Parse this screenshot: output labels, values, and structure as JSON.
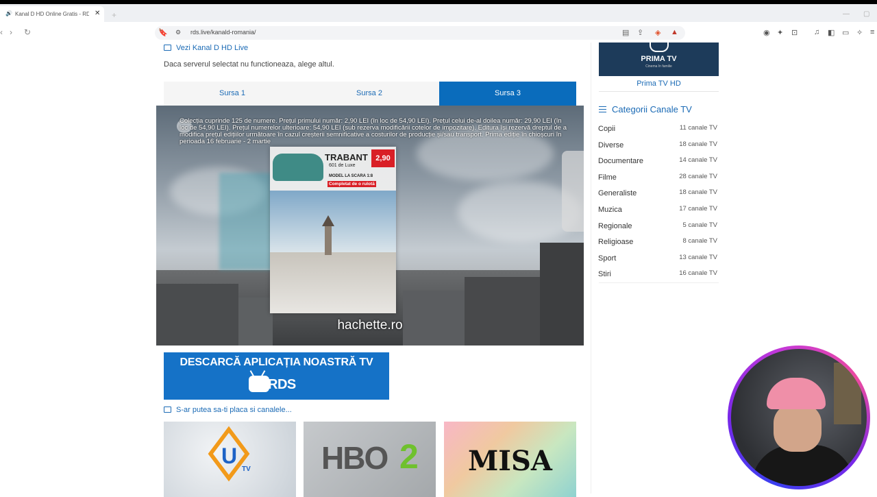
{
  "browser": {
    "tab_title": "Kanal D HD Online Gratis - RDS",
    "tab_audio_icon": "speaker-icon",
    "url": "rds.live/kanald-romania/"
  },
  "page": {
    "live_title": "Vezi Kanal D HD Live",
    "server_note": "Daca serverul selectat nu functioneaza, alege altul.",
    "sources": [
      "Sursa 1",
      "Sursa 2",
      "Sursa 3"
    ],
    "active_source": "Sursa 3",
    "player": {
      "disclaimer": "Colecția cuprinde 125 de numere. Prețul primului număr: 2,90 LEI (în loc de 54,90 LEI). Prețul celui de-al doilea număr: 29,90 LEI (în loc de 54,90 LEI). Prețul numerelor ulterioare: 54,90 LEI (sub rezerva modificării cotelor de impozitare). Editura își rezervă dreptul de a modifica prețul edițiilor următoare în cazul creșterii semnificative a costurilor de producție și/sau transport. Prima ediție în chioșcuri în perioada 16 februarie - 2 martie",
      "ad_title": "TRABANT",
      "ad_price": "2,90",
      "ad_sub1": "601 de Luxe",
      "ad_sub2": "MODEL LA SCARA 1:8",
      "ad_sub3": "Completat de o rulotă",
      "watermark": "hachette.ro"
    },
    "app_banner": {
      "text": "DESCARCĂ APLICAȚIA NOASTRĂ TV",
      "brand": "RDS"
    },
    "suggest_title": "S-ar putea sa-ti placa si canalele...",
    "thumbs": [
      {
        "name": "QU TV",
        "label": "TV"
      },
      {
        "name": "HBO2",
        "hbo": "HBO",
        "two": "2"
      },
      {
        "name": "MISA",
        "label": "MISA"
      }
    ]
  },
  "sidebar": {
    "prima": {
      "logo": "PRIMA TV",
      "tagline": "Cinema în familie",
      "label": "Prima TV HD"
    },
    "categories_title_a": "Categorii",
    "categories_title_b": "Canale TV",
    "categories": [
      {
        "name": "Copii",
        "count": "11 canale TV"
      },
      {
        "name": "Diverse",
        "count": "18 canale TV"
      },
      {
        "name": "Documentare",
        "count": "14 canale TV"
      },
      {
        "name": "Filme",
        "count": "28 canale TV"
      },
      {
        "name": "Generaliste",
        "count": "18 canale TV"
      },
      {
        "name": "Muzica",
        "count": "17 canale TV"
      },
      {
        "name": "Regionale",
        "count": "5 canale TV"
      },
      {
        "name": "Religioase",
        "count": "8 canale TV"
      },
      {
        "name": "Sport",
        "count": "13 canale TV"
      },
      {
        "name": "Stiri",
        "count": "16 canale TV"
      }
    ]
  },
  "colors": {
    "accent": "#0a6cbc",
    "link": "#1a6ab5",
    "banner": "#1572c7"
  }
}
